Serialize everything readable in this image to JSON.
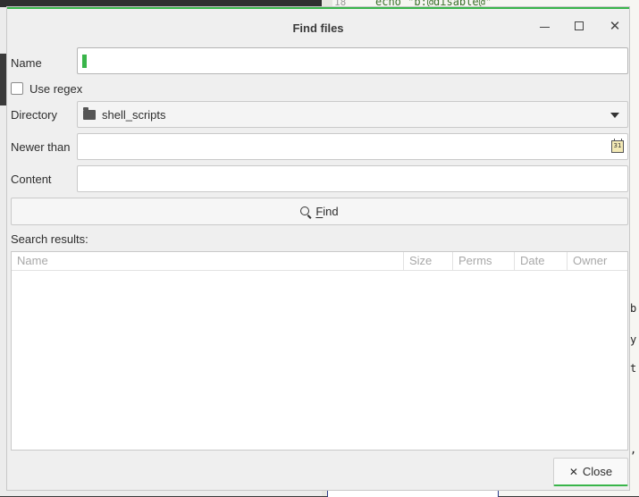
{
  "background": {
    "line_number": "18",
    "code_line": "echo \"b:@disable@\"",
    "right_fragments": [
      "b",
      "y",
      "t",
      ","
    ]
  },
  "dialog": {
    "title": "Find files",
    "name_label": "Name",
    "name_value": "",
    "use_regex_label": "Use regex",
    "use_regex_checked": false,
    "directory_label": "Directory",
    "directory_value": "shell_scripts",
    "newer_than_label": "Newer than",
    "newer_than_value": "",
    "calendar_icon_text": "31",
    "content_label": "Content",
    "content_value": "",
    "find_button_mnemonic": "F",
    "find_button_rest": "ind",
    "search_results_label": "Search results:",
    "columns": [
      "Name",
      "Size",
      "Perms",
      "Date",
      "Owner"
    ],
    "rows": [],
    "close_button_label": "Close",
    "accent_color": "#39b54a"
  }
}
